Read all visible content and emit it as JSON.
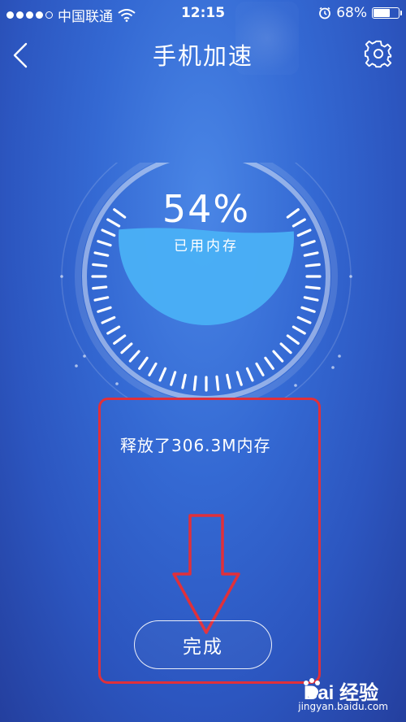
{
  "status_bar": {
    "carrier": "中国联通",
    "time": "12:15",
    "battery_percent": "68%",
    "battery_level": 0.68,
    "signal_bars_filled": 4,
    "signal_bars_total": 5
  },
  "nav": {
    "title": "手机加速",
    "back_icon": "chevron-left-icon",
    "settings_icon": "gear-icon"
  },
  "gauge": {
    "percent_text": "54%",
    "percent_value": 54,
    "label": "已用内存"
  },
  "result": {
    "released_text": "释放了306.3M内存"
  },
  "actions": {
    "done_label": "完成"
  },
  "watermark": {
    "brand": "Bai 经验",
    "domain": "jingyan.baidu.com"
  },
  "colors": {
    "background": "#3469d3",
    "water": "#4ab0f5",
    "annotation_red": "#e0303a"
  }
}
